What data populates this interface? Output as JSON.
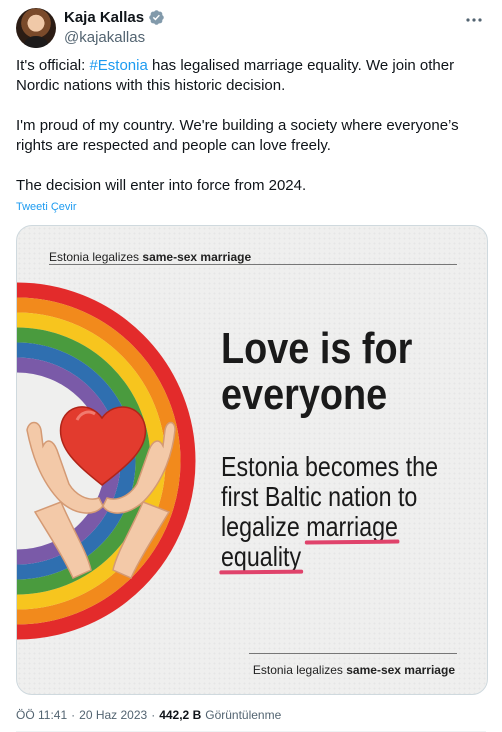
{
  "author": {
    "name": "Kaja Kallas",
    "handle": "@kajakallas",
    "avatar_icon": "avatar-photo",
    "verified_icon": "verified-badge-icon",
    "verified_color": "#829aab"
  },
  "tweet": {
    "line1_before": "It's official: ",
    "hashtag": "#Estonia",
    "line1_after": " has legalised marriage equality. We join other Nordic nations with this historic decision.",
    "paragraph2": "I'm proud of my country. We're building a society where everyone’s rights are respected and people can love freely.",
    "paragraph3": "The decision will enter into force from 2024.",
    "translate_label": "Tweeti Çevir"
  },
  "media": {
    "top_caption_prefix": "Estonia legalizes ",
    "top_caption_bold": "same-sex marriage",
    "headline_line1": "Love is for",
    "headline_line2": "everyone",
    "sub_line1": "Estonia becomes the",
    "sub_line2": "first Baltic nation to",
    "sub_line3_prefix": "legalize ",
    "sub_line3_underlined": "marriage",
    "sub_line4_underlined": "equality",
    "bottom_caption_prefix": "Estonia legalizes ",
    "bottom_caption_bold": "same-sex marriage",
    "accent_color": "#e0436b"
  },
  "meta": {
    "time": "ÖÖ 11:41",
    "separator": "·",
    "date": "20 Haz 2023",
    "views_count": "442,2 B",
    "views_label": "Görüntülenme"
  }
}
